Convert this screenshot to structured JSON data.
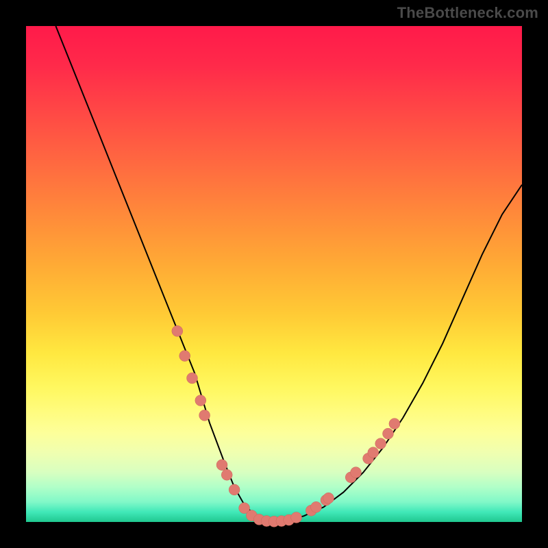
{
  "watermark": "TheBottleneck.com",
  "chart_data": {
    "type": "line",
    "title": "",
    "xlabel": "",
    "ylabel": "",
    "xlim": [
      0,
      1
    ],
    "ylim": [
      0,
      1
    ],
    "series": [
      {
        "name": "curve",
        "x": [
          0.06,
          0.1,
          0.14,
          0.18,
          0.22,
          0.26,
          0.3,
          0.34,
          0.37,
          0.4,
          0.42,
          0.44,
          0.46,
          0.48,
          0.5,
          0.53,
          0.56,
          0.6,
          0.64,
          0.68,
          0.72,
          0.76,
          0.8,
          0.84,
          0.88,
          0.92,
          0.96,
          1.0
        ],
        "y": [
          1.0,
          0.9,
          0.8,
          0.7,
          0.6,
          0.5,
          0.4,
          0.3,
          0.2,
          0.12,
          0.07,
          0.035,
          0.015,
          0.005,
          0.002,
          0.004,
          0.012,
          0.03,
          0.06,
          0.1,
          0.15,
          0.21,
          0.28,
          0.36,
          0.45,
          0.54,
          0.62,
          0.68
        ]
      }
    ],
    "dots": [
      {
        "x": 0.305,
        "y": 0.385
      },
      {
        "x": 0.32,
        "y": 0.335
      },
      {
        "x": 0.335,
        "y": 0.29
      },
      {
        "x": 0.352,
        "y": 0.245
      },
      {
        "x": 0.36,
        "y": 0.215
      },
      {
        "x": 0.395,
        "y": 0.115
      },
      {
        "x": 0.405,
        "y": 0.095
      },
      {
        "x": 0.42,
        "y": 0.065
      },
      {
        "x": 0.44,
        "y": 0.028
      },
      {
        "x": 0.455,
        "y": 0.013
      },
      {
        "x": 0.47,
        "y": 0.005
      },
      {
        "x": 0.485,
        "y": 0.002
      },
      {
        "x": 0.5,
        "y": 0.001
      },
      {
        "x": 0.515,
        "y": 0.002
      },
      {
        "x": 0.53,
        "y": 0.004
      },
      {
        "x": 0.545,
        "y": 0.009
      },
      {
        "x": 0.575,
        "y": 0.023
      },
      {
        "x": 0.585,
        "y": 0.03
      },
      {
        "x": 0.605,
        "y": 0.044
      },
      {
        "x": 0.61,
        "y": 0.048
      },
      {
        "x": 0.655,
        "y": 0.09
      },
      {
        "x": 0.665,
        "y": 0.1
      },
      {
        "x": 0.69,
        "y": 0.128
      },
      {
        "x": 0.7,
        "y": 0.14
      },
      {
        "x": 0.715,
        "y": 0.158
      },
      {
        "x": 0.73,
        "y": 0.178
      },
      {
        "x": 0.743,
        "y": 0.198
      }
    ],
    "dot_radius": 8
  }
}
